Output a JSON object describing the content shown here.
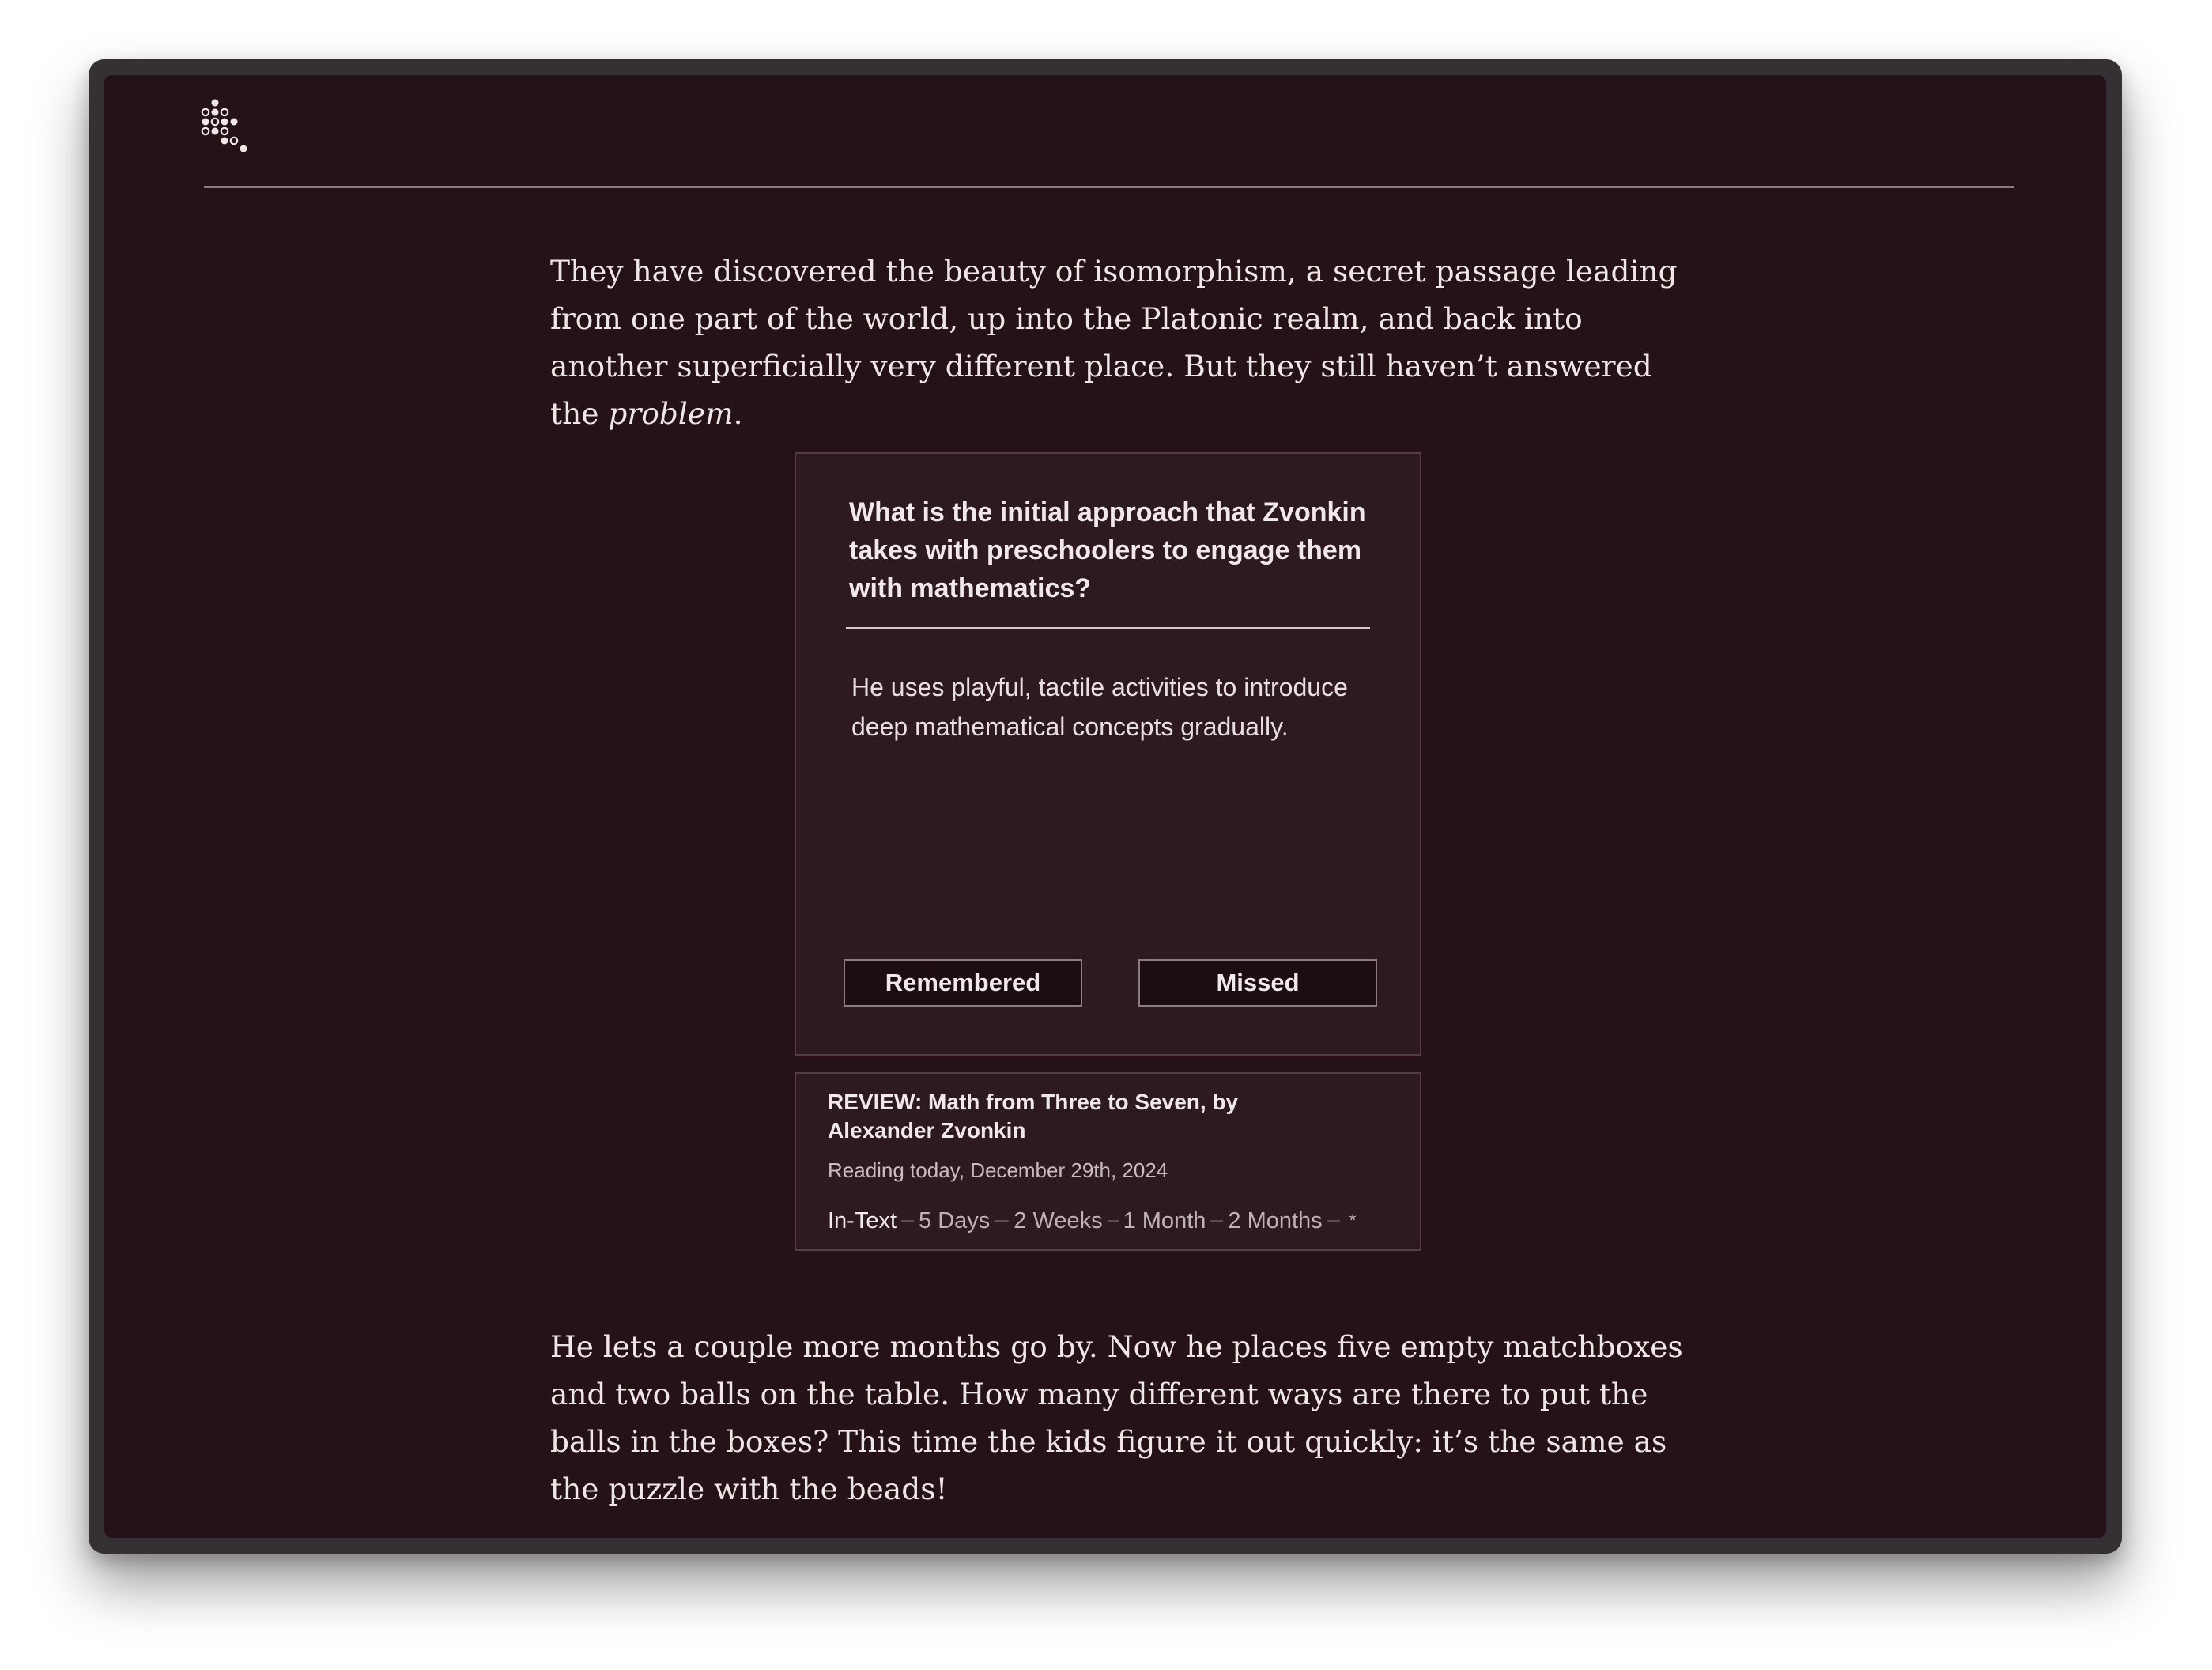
{
  "article": {
    "paragraph_1": {
      "text_before": "They have discovered the beauty of isomorphism, a secret passage leading from one part of the world, up into the Platonic realm, and back into another superficially very different place. But they still haven’t answered the ",
      "emphasis": "problem",
      "text_after": "."
    },
    "paragraph_2": "He lets a couple more months go by. Now he places five empty matchboxes and two balls on the table. How many different ways are there to put the balls in the boxes? This time the kids figure it out quickly: it’s the same as the puzzle with the beads!"
  },
  "review_card": {
    "question": "What is the initial approach that Zvonkin takes with preschoolers to engage them with mathematics?",
    "answer": "He uses playful, tactile activities to introduce deep mathematical concepts gradually.",
    "remembered_label": "Remembered",
    "missed_label": "Missed"
  },
  "source": {
    "title": "REVIEW: Math from Three to Seven, by Alexander Zvonkin",
    "date": "Reading today, December 29th, 2024",
    "schedule": [
      "In-Text",
      "5 Days",
      "2 Weeks",
      "1 Month",
      "2 Months"
    ],
    "schedule_end": "*"
  },
  "icons": {
    "logo": "bead-cluster-logo-icon"
  },
  "colors": {
    "background": "#241218",
    "card": "#2d1a20",
    "text": "#efe6e6"
  }
}
